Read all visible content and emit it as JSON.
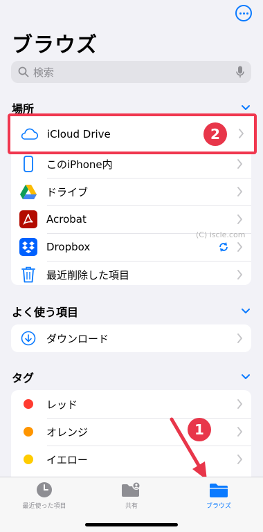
{
  "page": {
    "title": "ブラウズ",
    "more_icon": "ellipsis-circle-icon",
    "watermark": "(C) iscle.com"
  },
  "search": {
    "placeholder": "検索",
    "icon": "magnifier-icon",
    "mic_icon": "microphone-icon"
  },
  "locations": {
    "title": "場所",
    "items": [
      {
        "label": "iCloud Drive",
        "icon": "icloud-icon"
      },
      {
        "label": "このiPhone内",
        "icon": "iphone-icon"
      },
      {
        "label": "ドライブ",
        "icon": "google-drive-icon"
      },
      {
        "label": "Acrobat",
        "icon": "acrobat-icon"
      },
      {
        "label": "Dropbox",
        "icon": "dropbox-icon",
        "status_icon": "sync-icon"
      },
      {
        "label": "最近削除した項目",
        "icon": "trash-icon"
      }
    ]
  },
  "favorites": {
    "title": "よく使う項目",
    "items": [
      {
        "label": "ダウンロード",
        "icon": "download-circle-icon"
      }
    ]
  },
  "tags": {
    "title": "タグ",
    "items": [
      {
        "label": "レッド",
        "color": "#ff3b30"
      },
      {
        "label": "オレンジ",
        "color": "#ff9500"
      },
      {
        "label": "イエロー",
        "color": "#ffcc00"
      }
    ]
  },
  "annotations": {
    "badge_1": "1",
    "badge_2": "2",
    "color": "#e8364a"
  },
  "tabbar": {
    "tabs": [
      {
        "label": "最近使った項目",
        "icon": "clock-icon",
        "active": false
      },
      {
        "label": "共有",
        "icon": "shared-folder-icon",
        "active": false
      },
      {
        "label": "ブラウズ",
        "icon": "folder-icon",
        "active": true
      }
    ],
    "accent": "#0a7aff"
  }
}
